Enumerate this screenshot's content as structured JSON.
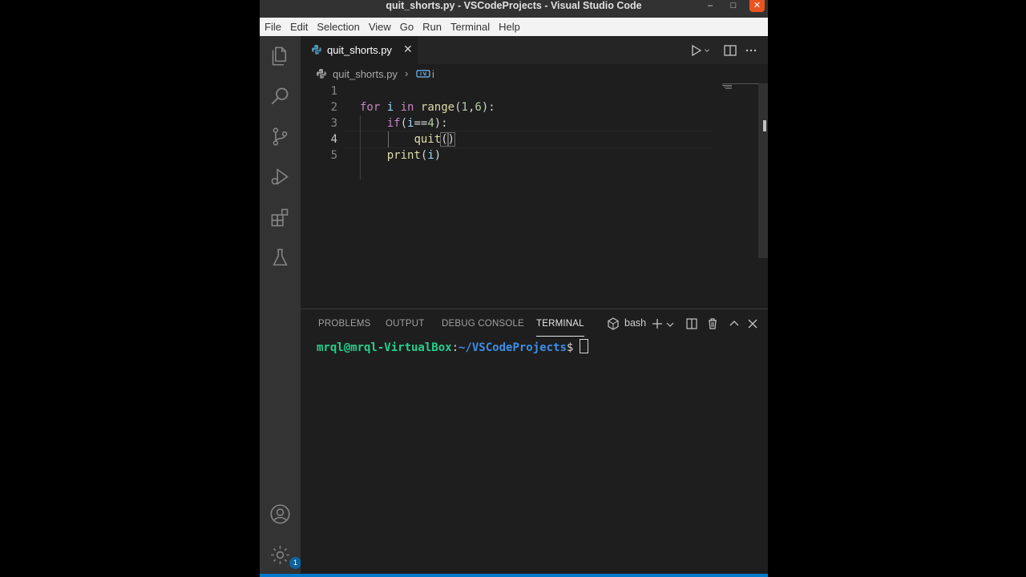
{
  "window": {
    "title": "quit_shorts.py - VSCodeProjects - Visual Studio Code",
    "controls": {
      "minimize": "–",
      "maximize": "□",
      "close": "✕"
    }
  },
  "menu": [
    "File",
    "Edit",
    "Selection",
    "View",
    "Go",
    "Run",
    "Terminal",
    "Help"
  ],
  "activity_bar": {
    "items": [
      "explorer-icon",
      "search-icon",
      "source-control-icon",
      "run-debug-icon",
      "extensions-icon",
      "testing-icon"
    ],
    "bottom": [
      "account-icon",
      "manage-gear-icon"
    ],
    "manage_badge": "1"
  },
  "editor": {
    "tab": {
      "file_name": "quit_shorts.py",
      "close": "✕"
    },
    "breadcrumb": {
      "file": "quit_shorts.py",
      "separator": "›",
      "symbol": "i"
    },
    "line_numbers": [
      "1",
      "2",
      "3",
      "4",
      "5"
    ],
    "active_line": "4",
    "code_lines": [
      "",
      "for i in range(1,6):",
      "    if(i==4):",
      "        quit()",
      "    print(i)"
    ]
  },
  "panel": {
    "tabs": [
      "PROBLEMS",
      "OUTPUT",
      "DEBUG CONSOLE",
      "TERMINAL"
    ],
    "active_tab": "TERMINAL",
    "shell": "bash",
    "terminal": {
      "user_host": "mrql@mrql-VirtualBox",
      "colon": ":",
      "path": "~/VSCodeProjects",
      "prompt": "$"
    }
  },
  "colors": {
    "status_bar": "#007acc",
    "close_button": "#e95420",
    "keyword": "#c586c0",
    "function": "#dcdcaa",
    "terminal_user": "#23d18b",
    "terminal_path": "#3b8eea"
  }
}
